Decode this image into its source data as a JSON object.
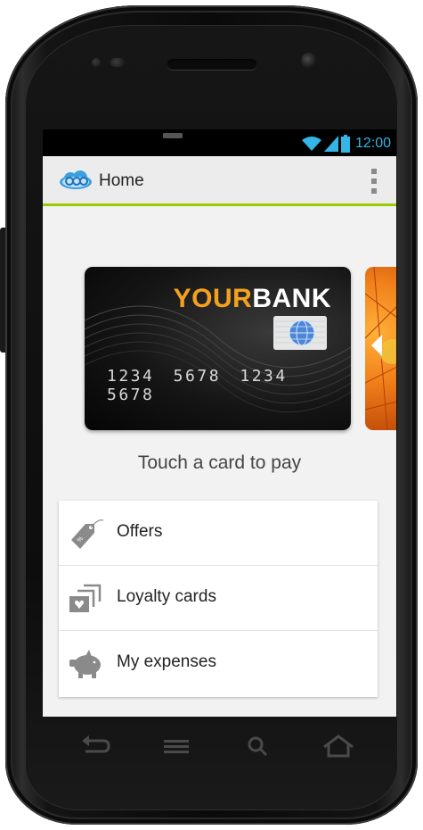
{
  "status_bar": {
    "time": "12:00",
    "icons": [
      "wifi-icon",
      "signal-icon",
      "battery-icon"
    ],
    "accent_color": "#33b5e5"
  },
  "action_bar": {
    "title": "Home",
    "logo_icon": "cloud-logo-icon",
    "overflow_icon": "overflow-menu-icon",
    "divider_color": "#99cc00"
  },
  "cards": [
    {
      "bank_name_part1": "YOUR",
      "bank_name_part2": "BANK",
      "number": "1234 5678 1234 5678"
    }
  ],
  "touch_prompt": "Touch a card to pay",
  "menu": {
    "items": [
      {
        "label": "Offers",
        "icon": "price-tag-icon"
      },
      {
        "label": "Loyalty cards",
        "icon": "loyalty-cards-icon"
      },
      {
        "label": "My expenses",
        "icon": "piggy-bank-icon"
      }
    ]
  },
  "nav_bar": {
    "buttons": [
      "back-icon",
      "menu-icon",
      "search-icon",
      "home-icon"
    ]
  }
}
